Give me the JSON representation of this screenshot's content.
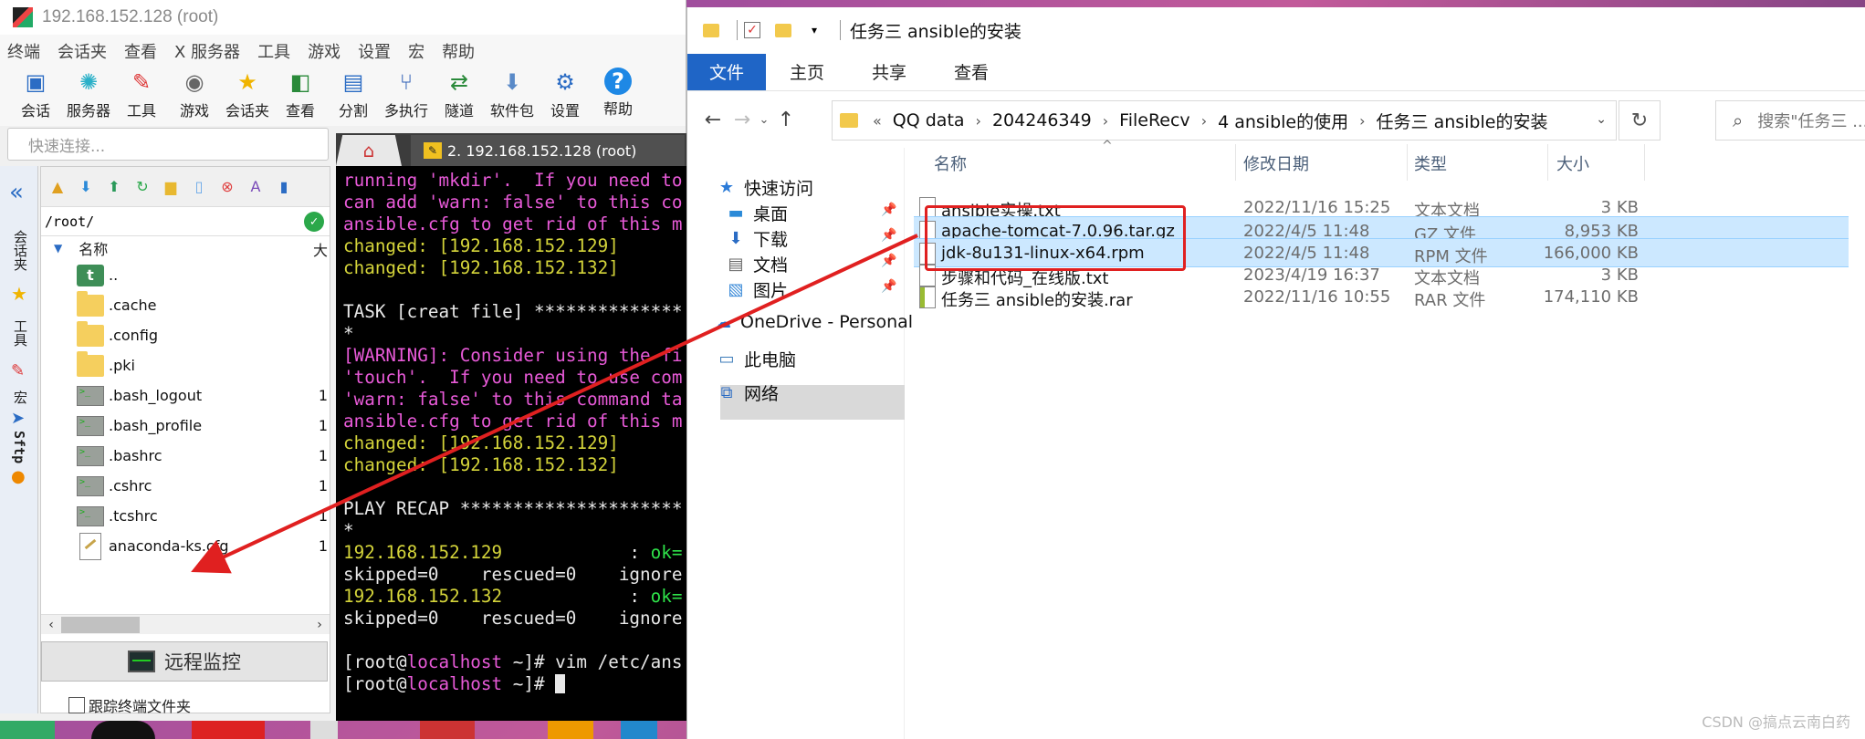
{
  "xshell": {
    "title": "192.168.152.128 (root)",
    "menu": [
      "终端",
      "会话夹",
      "查看",
      "X 服务器",
      "工具",
      "游戏",
      "设置",
      "宏",
      "帮助"
    ],
    "toolbar": [
      {
        "label": "会话",
        "icon": "session-icon"
      },
      {
        "label": "服务器",
        "icon": "server-icon"
      },
      {
        "label": "工具",
        "icon": "tools-icon"
      },
      {
        "label": "游戏",
        "icon": "gamepad-icon"
      },
      {
        "label": "会话夹",
        "icon": "star-icon"
      },
      {
        "label": "查看",
        "icon": "view-icon"
      },
      {
        "label": "分割",
        "icon": "split-icon"
      },
      {
        "label": "多执行",
        "icon": "multi-exec-icon"
      },
      {
        "label": "隧道",
        "icon": "tunnel-icon"
      },
      {
        "label": "软件包",
        "icon": "package-icon"
      },
      {
        "label": "设置",
        "icon": "settings-icon"
      },
      {
        "label": "帮助",
        "icon": "help-icon"
      }
    ],
    "quick_connect_placeholder": "快速连接...",
    "side_tabs": [
      "会话夹",
      "工具",
      "宏",
      "Sftp"
    ],
    "sftp": {
      "path": "/root/",
      "col_name": "名称",
      "col_size_stub": "大",
      "files": [
        {
          "name": "..",
          "type": "up",
          "num": ""
        },
        {
          "name": ".cache",
          "type": "folder",
          "num": ""
        },
        {
          "name": ".config",
          "type": "folder",
          "num": ""
        },
        {
          "name": ".pki",
          "type": "folder",
          "num": ""
        },
        {
          "name": ".bash_logout",
          "type": "file",
          "num": "1"
        },
        {
          "name": ".bash_profile",
          "type": "file",
          "num": "1"
        },
        {
          "name": ".bashrc",
          "type": "file",
          "num": "1"
        },
        {
          "name": ".cshrc",
          "type": "file",
          "num": "1"
        },
        {
          "name": ".tcshrc",
          "type": "file",
          "num": "1"
        },
        {
          "name": "anaconda-ks.cfg",
          "type": "cfg",
          "num": "1"
        }
      ],
      "remote_monitor_label": "远程监控",
      "follow_terminal_label": "跟踪终端文件夹"
    },
    "tab_label": "2. 192.168.152.128 (root)",
    "terminal_lines": [
      [
        {
          "t": "running 'mkdir'.  If you need to",
          "c": "pink"
        }
      ],
      [
        {
          "t": "can add 'warn: false' to this co",
          "c": "pink"
        }
      ],
      [
        {
          "t": "ansible.cfg to get rid of this m",
          "c": "pink"
        }
      ],
      [
        {
          "t": "changed: [192.168.152.129]",
          "c": "yellow"
        }
      ],
      [
        {
          "t": "changed: [192.168.152.132]",
          "c": "yellow"
        }
      ],
      [
        {
          "t": "",
          "c": "white"
        }
      ],
      [
        {
          "t": "TASK [creat file] **************",
          "c": "white"
        }
      ],
      [
        {
          "t": "*",
          "c": "white"
        }
      ],
      [
        {
          "t": "[WARNING]: Consider using the fi",
          "c": "pink"
        }
      ],
      [
        {
          "t": "'touch'.  If you need to use com",
          "c": "pink"
        }
      ],
      [
        {
          "t": "'warn: false' to this command ta",
          "c": "pink"
        }
      ],
      [
        {
          "t": "ansible.cfg to get rid of this m",
          "c": "pink"
        }
      ],
      [
        {
          "t": "changed: [192.168.152.129]",
          "c": "yellow"
        }
      ],
      [
        {
          "t": "changed: [192.168.152.132]",
          "c": "yellow"
        }
      ],
      [
        {
          "t": "",
          "c": "white"
        }
      ],
      [
        {
          "t": "PLAY RECAP *********************",
          "c": "white"
        }
      ],
      [
        {
          "t": "*",
          "c": "white"
        }
      ],
      [
        {
          "t": "192.168.152.129",
          "c": "yellow"
        },
        {
          "t": "            : ",
          "c": "white"
        },
        {
          "t": "ok=",
          "c": "green"
        }
      ],
      [
        {
          "t": "skipped=0    rescued=0    ignore",
          "c": "white"
        }
      ],
      [
        {
          "t": "192.168.152.132",
          "c": "yellow"
        },
        {
          "t": "            : ",
          "c": "white"
        },
        {
          "t": "ok=",
          "c": "green"
        }
      ],
      [
        {
          "t": "skipped=0    rescued=0    ignore",
          "c": "white"
        }
      ],
      [
        {
          "t": "",
          "c": "white"
        }
      ],
      [
        {
          "t": "[root@",
          "c": "white"
        },
        {
          "t": "localhost",
          "c": "pink"
        },
        {
          "t": " ~]# vim /etc/ans",
          "c": "white"
        }
      ],
      [
        {
          "t": "[root@",
          "c": "white"
        },
        {
          "t": "localhost",
          "c": "pink"
        },
        {
          "t": " ~]# ",
          "c": "white"
        },
        {
          "t": "",
          "c": "cursor"
        }
      ]
    ]
  },
  "explorer": {
    "title": "任务三 ansible的安装",
    "ribbon_tabs": [
      "文件",
      "主页",
      "共享",
      "查看"
    ],
    "breadcrumb_prefix": "«",
    "breadcrumb": [
      "QQ data",
      "204246349",
      "FileRecv",
      "4 ansible的使用",
      "任务三 ansible的安装"
    ],
    "search_placeholder": "搜索\"任务三 ...",
    "nav": [
      {
        "label": "快速访问",
        "icon": "star-icon"
      },
      {
        "label": "桌面",
        "icon": "desktop-icon"
      },
      {
        "label": "下载",
        "icon": "download-icon"
      },
      {
        "label": "文档",
        "icon": "document-icon"
      },
      {
        "label": "图片",
        "icon": "pictures-icon"
      },
      {
        "label": "OneDrive - Personal",
        "icon": "cloud-icon"
      },
      {
        "label": "此电脑",
        "icon": "computer-icon"
      },
      {
        "label": "网络",
        "icon": "network-icon"
      }
    ],
    "columns": {
      "name": "名称",
      "date": "修改日期",
      "type": "类型",
      "size": "大小"
    },
    "files": [
      {
        "name": "ansible实操.txt",
        "date": "2022/11/16 15:25",
        "type": "文本文档",
        "size": "3 KB",
        "icon": "text-file-icon",
        "selected": false
      },
      {
        "name": "apache-tomcat-7.0.96.tar.gz",
        "date": "2022/4/5 11:48",
        "type": "GZ 文件",
        "size": "8,953 KB",
        "icon": "gz-file-icon",
        "selected": true
      },
      {
        "name": "jdk-8u131-linux-x64.rpm",
        "date": "2022/4/5 11:48",
        "type": "RPM 文件",
        "size": "166,000 KB",
        "icon": "rpm-file-icon",
        "selected": true
      },
      {
        "name": "步骤和代码_在线版.txt",
        "date": "2023/4/19 16:37",
        "type": "文本文档",
        "size": "3 KB",
        "icon": "text-file-icon",
        "selected": false
      },
      {
        "name": "任务三 ansible的安装.rar",
        "date": "2022/11/16 10:55",
        "type": "RAR 文件",
        "size": "174,110 KB",
        "icon": "rar-file-icon",
        "selected": false
      }
    ]
  },
  "watermark": "CSDN @搞点云南白药",
  "colors": {
    "annotation_red": "#e02020",
    "ribbon_blue": "#1f65c6",
    "selection_blue": "#cce8ff"
  }
}
